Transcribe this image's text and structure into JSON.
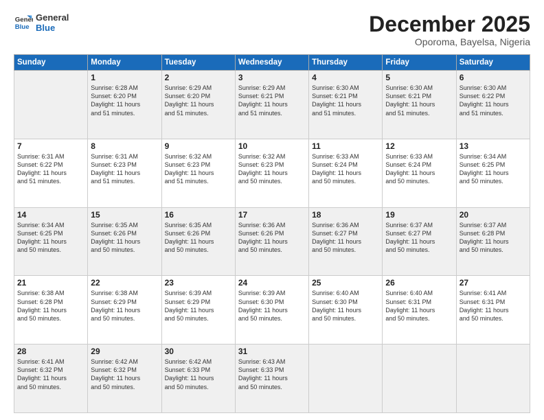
{
  "header": {
    "logo_line1": "General",
    "logo_line2": "Blue",
    "month": "December 2025",
    "location": "Oporoma, Bayelsa, Nigeria"
  },
  "weekdays": [
    "Sunday",
    "Monday",
    "Tuesday",
    "Wednesday",
    "Thursday",
    "Friday",
    "Saturday"
  ],
  "weeks": [
    [
      {
        "day": "",
        "info": ""
      },
      {
        "day": "1",
        "info": "Sunrise: 6:28 AM\nSunset: 6:20 PM\nDaylight: 11 hours\nand 51 minutes."
      },
      {
        "day": "2",
        "info": "Sunrise: 6:29 AM\nSunset: 6:20 PM\nDaylight: 11 hours\nand 51 minutes."
      },
      {
        "day": "3",
        "info": "Sunrise: 6:29 AM\nSunset: 6:21 PM\nDaylight: 11 hours\nand 51 minutes."
      },
      {
        "day": "4",
        "info": "Sunrise: 6:30 AM\nSunset: 6:21 PM\nDaylight: 11 hours\nand 51 minutes."
      },
      {
        "day": "5",
        "info": "Sunrise: 6:30 AM\nSunset: 6:21 PM\nDaylight: 11 hours\nand 51 minutes."
      },
      {
        "day": "6",
        "info": "Sunrise: 6:30 AM\nSunset: 6:22 PM\nDaylight: 11 hours\nand 51 minutes."
      }
    ],
    [
      {
        "day": "7",
        "info": "Sunrise: 6:31 AM\nSunset: 6:22 PM\nDaylight: 11 hours\nand 51 minutes."
      },
      {
        "day": "8",
        "info": "Sunrise: 6:31 AM\nSunset: 6:23 PM\nDaylight: 11 hours\nand 51 minutes."
      },
      {
        "day": "9",
        "info": "Sunrise: 6:32 AM\nSunset: 6:23 PM\nDaylight: 11 hours\nand 51 minutes."
      },
      {
        "day": "10",
        "info": "Sunrise: 6:32 AM\nSunset: 6:23 PM\nDaylight: 11 hours\nand 50 minutes."
      },
      {
        "day": "11",
        "info": "Sunrise: 6:33 AM\nSunset: 6:24 PM\nDaylight: 11 hours\nand 50 minutes."
      },
      {
        "day": "12",
        "info": "Sunrise: 6:33 AM\nSunset: 6:24 PM\nDaylight: 11 hours\nand 50 minutes."
      },
      {
        "day": "13",
        "info": "Sunrise: 6:34 AM\nSunset: 6:25 PM\nDaylight: 11 hours\nand 50 minutes."
      }
    ],
    [
      {
        "day": "14",
        "info": "Sunrise: 6:34 AM\nSunset: 6:25 PM\nDaylight: 11 hours\nand 50 minutes."
      },
      {
        "day": "15",
        "info": "Sunrise: 6:35 AM\nSunset: 6:26 PM\nDaylight: 11 hours\nand 50 minutes."
      },
      {
        "day": "16",
        "info": "Sunrise: 6:35 AM\nSunset: 6:26 PM\nDaylight: 11 hours\nand 50 minutes."
      },
      {
        "day": "17",
        "info": "Sunrise: 6:36 AM\nSunset: 6:26 PM\nDaylight: 11 hours\nand 50 minutes."
      },
      {
        "day": "18",
        "info": "Sunrise: 6:36 AM\nSunset: 6:27 PM\nDaylight: 11 hours\nand 50 minutes."
      },
      {
        "day": "19",
        "info": "Sunrise: 6:37 AM\nSunset: 6:27 PM\nDaylight: 11 hours\nand 50 minutes."
      },
      {
        "day": "20",
        "info": "Sunrise: 6:37 AM\nSunset: 6:28 PM\nDaylight: 11 hours\nand 50 minutes."
      }
    ],
    [
      {
        "day": "21",
        "info": "Sunrise: 6:38 AM\nSunset: 6:28 PM\nDaylight: 11 hours\nand 50 minutes."
      },
      {
        "day": "22",
        "info": "Sunrise: 6:38 AM\nSunset: 6:29 PM\nDaylight: 11 hours\nand 50 minutes."
      },
      {
        "day": "23",
        "info": "Sunrise: 6:39 AM\nSunset: 6:29 PM\nDaylight: 11 hours\nand 50 minutes."
      },
      {
        "day": "24",
        "info": "Sunrise: 6:39 AM\nSunset: 6:30 PM\nDaylight: 11 hours\nand 50 minutes."
      },
      {
        "day": "25",
        "info": "Sunrise: 6:40 AM\nSunset: 6:30 PM\nDaylight: 11 hours\nand 50 minutes."
      },
      {
        "day": "26",
        "info": "Sunrise: 6:40 AM\nSunset: 6:31 PM\nDaylight: 11 hours\nand 50 minutes."
      },
      {
        "day": "27",
        "info": "Sunrise: 6:41 AM\nSunset: 6:31 PM\nDaylight: 11 hours\nand 50 minutes."
      }
    ],
    [
      {
        "day": "28",
        "info": "Sunrise: 6:41 AM\nSunset: 6:32 PM\nDaylight: 11 hours\nand 50 minutes."
      },
      {
        "day": "29",
        "info": "Sunrise: 6:42 AM\nSunset: 6:32 PM\nDaylight: 11 hours\nand 50 minutes."
      },
      {
        "day": "30",
        "info": "Sunrise: 6:42 AM\nSunset: 6:33 PM\nDaylight: 11 hours\nand 50 minutes."
      },
      {
        "day": "31",
        "info": "Sunrise: 6:43 AM\nSunset: 6:33 PM\nDaylight: 11 hours\nand 50 minutes."
      },
      {
        "day": "",
        "info": ""
      },
      {
        "day": "",
        "info": ""
      },
      {
        "day": "",
        "info": ""
      }
    ]
  ]
}
